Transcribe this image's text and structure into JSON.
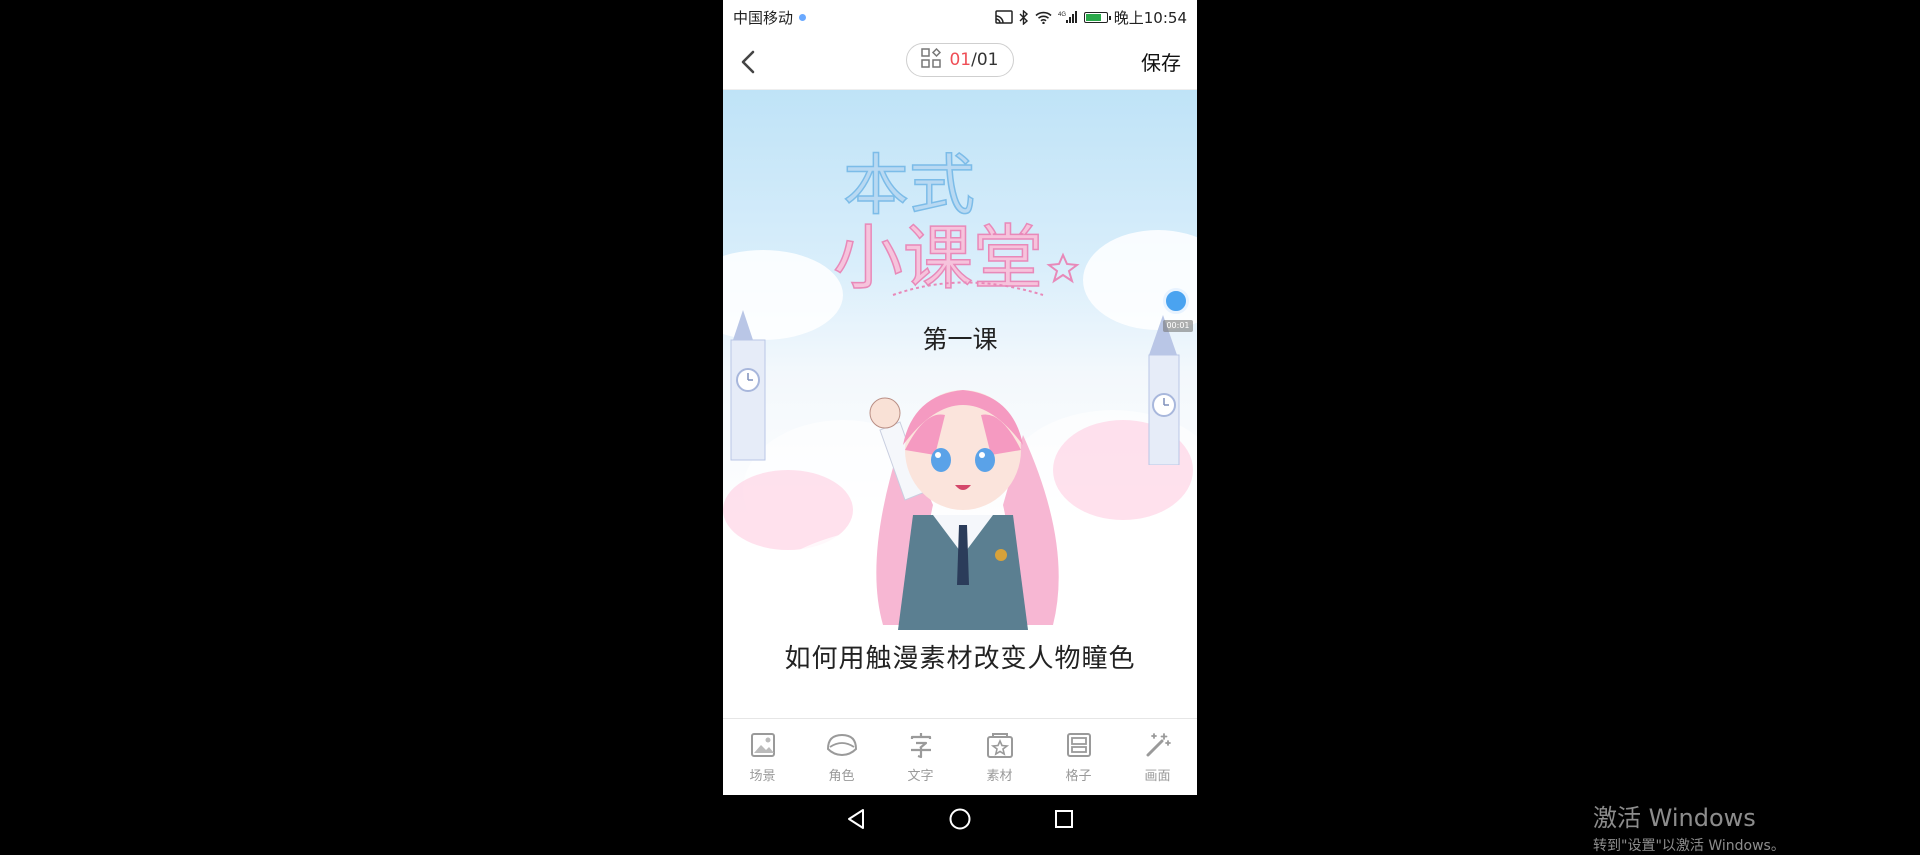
{
  "status_bar": {
    "carrier": "中国移动",
    "time": "晚上10:54",
    "signal_label": "4G"
  },
  "top_bar": {
    "page_current": "01",
    "page_separator": "/",
    "page_total": "01",
    "save_label": "保存"
  },
  "canvas": {
    "logo_line1": "本式",
    "logo_line2": "小课堂",
    "lesson_number": "第一课",
    "lesson_title": "如何用触漫素材改变人物瞳色",
    "float_time": "00:01"
  },
  "toolbar": {
    "items": [
      {
        "label": "场景",
        "icon": "scene-icon"
      },
      {
        "label": "角色",
        "icon": "character-icon"
      },
      {
        "label": "文字",
        "icon": "text-icon"
      },
      {
        "label": "素材",
        "icon": "material-icon"
      },
      {
        "label": "格子",
        "icon": "panel-icon"
      },
      {
        "label": "画面",
        "icon": "magic-wand-icon"
      }
    ]
  },
  "watermark": {
    "title": "激活 Windows",
    "subtitle": "转到\"设置\"以激活 Windows。"
  },
  "colors": {
    "accent": "#ef4e56",
    "float_dot": "#4aa3f0",
    "battery": "#2aa84a"
  }
}
